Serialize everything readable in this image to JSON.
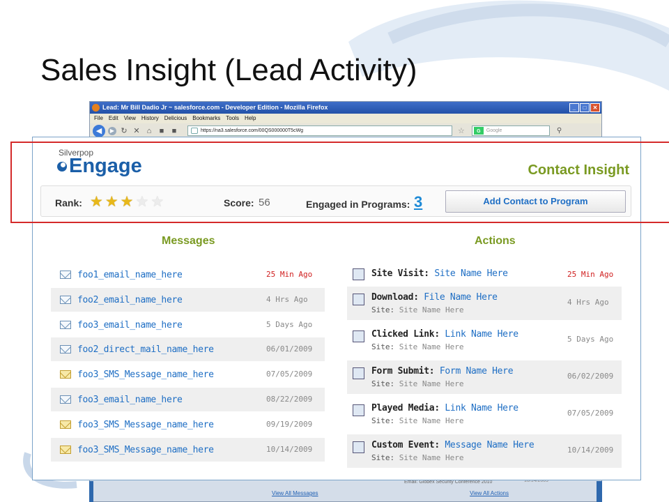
{
  "slide": {
    "title": "Sales Insight (Lead Activity)"
  },
  "browser": {
    "window_title": "Lead: Mr Bill Dadio Jr ~ salesforce.com - Developer Edition - Mozilla Firefox",
    "menu": [
      "File",
      "Edit",
      "View",
      "History",
      "Delicious",
      "Bookmarks",
      "Tools",
      "Help"
    ],
    "url": "https://na3.salesforce.com/00QS000000T5cWg",
    "search_placeholder": "Google"
  },
  "engage": {
    "brand_sub": "Silverpop",
    "brand_main": "Engage",
    "heading": "Contact Insight",
    "rank_label": "Rank:",
    "rank_value": 3,
    "rank_max": 5,
    "score_label": "Score:",
    "score_value": "56",
    "programs_label": "Engaged in Programs:",
    "programs_value": "3",
    "add_button": "Add Contact to Program"
  },
  "messages": {
    "heading": "Messages",
    "rows": [
      {
        "name": "foo1_email_name_here",
        "time": "25 Min Ago",
        "type": "email",
        "recent": true
      },
      {
        "name": "foo2_email_name_here",
        "time": "4 Hrs Ago",
        "type": "email",
        "recent": false
      },
      {
        "name": "foo3_email_name_here",
        "time": "5 Days Ago",
        "type": "email",
        "recent": false
      },
      {
        "name": "foo2_direct_mail_name_here",
        "time": "06/01/2009",
        "type": "email",
        "recent": false
      },
      {
        "name": "foo3_SMS_Message_name_here",
        "time": "07/05/2009",
        "type": "sms",
        "recent": false
      },
      {
        "name": "foo3_email_name_here",
        "time": "08/22/2009",
        "type": "email",
        "recent": false
      },
      {
        "name": "foo3_SMS_Message_name_here",
        "time": "09/19/2009",
        "type": "sms",
        "recent": false
      },
      {
        "name": "foo3_SMS_Message_name_here",
        "time": "10/14/2009",
        "type": "sms",
        "recent": false
      }
    ]
  },
  "actions": {
    "heading": "Actions",
    "site_label": "Site:",
    "rows": [
      {
        "type": "Site Visit:",
        "link": "Site Name Here",
        "site": "",
        "time": "25 Min Ago",
        "icon": "site-visit-icon",
        "recent": true
      },
      {
        "type": "Download:",
        "link": "File Name Here",
        "site": "Site Name Here",
        "time": "4 Hrs Ago",
        "icon": "download-icon",
        "recent": false
      },
      {
        "type": "Clicked Link:",
        "link": "Link Name Here",
        "site": "Site Name Here",
        "time": "5 Days Ago",
        "icon": "clicked-link-icon",
        "recent": false
      },
      {
        "type": "Form Submit:",
        "link": "Form Name Here",
        "site": "Site Name Here",
        "time": "06/02/2009",
        "icon": "form-icon",
        "recent": false
      },
      {
        "type": "Played Media:",
        "link": "Link Name Here",
        "site": "Site Name Here",
        "time": "07/05/2009",
        "icon": "media-icon",
        "recent": false
      },
      {
        "type": "Custom Event:",
        "link": "Message Name Here",
        "site": "Site Name Here",
        "time": "10/14/2009",
        "icon": "custom-event-icon",
        "recent": false
      }
    ]
  },
  "underlay": {
    "ghost_email": "Email: Globex Security Conference 2010",
    "ghost_date": "10/14/2009",
    "view_messages": "View All Messages",
    "view_actions": "View All Actions"
  },
  "colors": {
    "accent_green": "#7a9a22",
    "link_blue": "#1e6ec4",
    "recent_red": "#d02020",
    "highlight_red": "#d42a2a"
  }
}
